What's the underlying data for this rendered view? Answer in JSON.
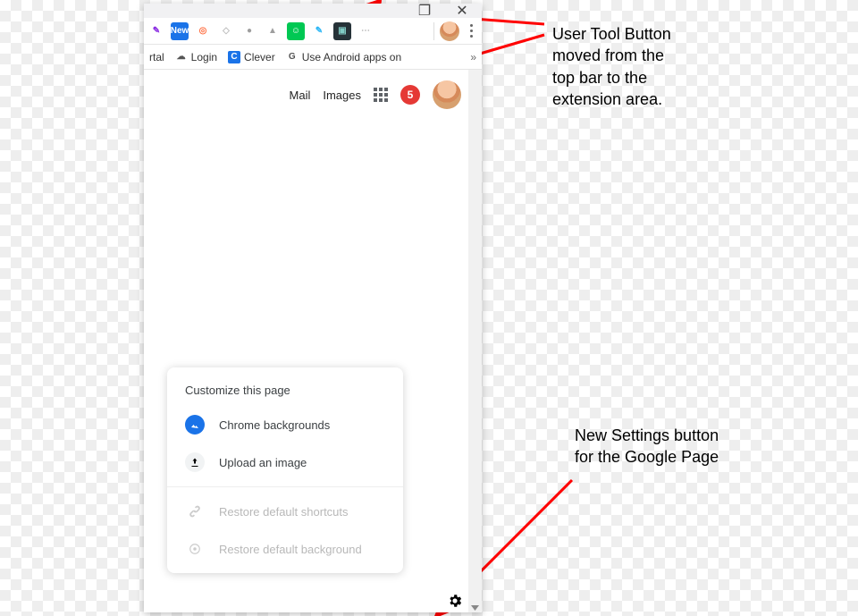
{
  "window_controls": {
    "restore": "❐",
    "close": "✕"
  },
  "extensions": [
    {
      "name": "ext-purple",
      "glyph": "✎",
      "bg": "#fff",
      "color": "#8a2be2"
    },
    {
      "name": "ext-new",
      "glyph": "New",
      "bg": "#1a73e8",
      "color": "#fff"
    },
    {
      "name": "ext-orange",
      "glyph": "◎",
      "bg": "#fff",
      "color": "#ff7043"
    },
    {
      "name": "ext-shield",
      "glyph": "◇",
      "bg": "#fff",
      "color": "#bdbdbd"
    },
    {
      "name": "ext-grey1",
      "glyph": "●",
      "bg": "#fff",
      "color": "#9e9e9e"
    },
    {
      "name": "ext-pdf",
      "glyph": "▲",
      "bg": "#fff",
      "color": "#9e9e9e"
    },
    {
      "name": "ext-green",
      "glyph": "☺",
      "bg": "#00c853",
      "color": "#fff"
    },
    {
      "name": "ext-note",
      "glyph": "✎",
      "bg": "#fff",
      "color": "#29b6f6"
    },
    {
      "name": "ext-dark",
      "glyph": "▣",
      "bg": "#263238",
      "color": "#80cbc4"
    },
    {
      "name": "ext-more",
      "glyph": "⋯",
      "bg": "#fff",
      "color": "#bbb"
    }
  ],
  "bookmarks": [
    {
      "name": "bk-rtal",
      "label": "rtal",
      "icon": "",
      "icon_bg": ""
    },
    {
      "name": "bk-login",
      "label": "Login",
      "icon": "☁",
      "icon_bg": "#fff"
    },
    {
      "name": "bk-clever",
      "label": "Clever",
      "icon": "C",
      "icon_bg": "#1a73e8"
    },
    {
      "name": "bk-android",
      "label": "Use Android apps on",
      "icon": "G",
      "icon_bg": "#fff"
    }
  ],
  "bookmarks_more": "»",
  "google_header": {
    "mail": "Mail",
    "images": "Images",
    "badge": "5"
  },
  "popup": {
    "title": "Customize this page",
    "backgrounds": "Chrome backgrounds",
    "upload": "Upload an image",
    "restore_shortcuts": "Restore default shortcuts",
    "restore_background": "Restore default background"
  },
  "captions": {
    "c1": "User Tool Button moved from the top bar to the extension area.",
    "c2": "New Settings button for the Google Page"
  }
}
